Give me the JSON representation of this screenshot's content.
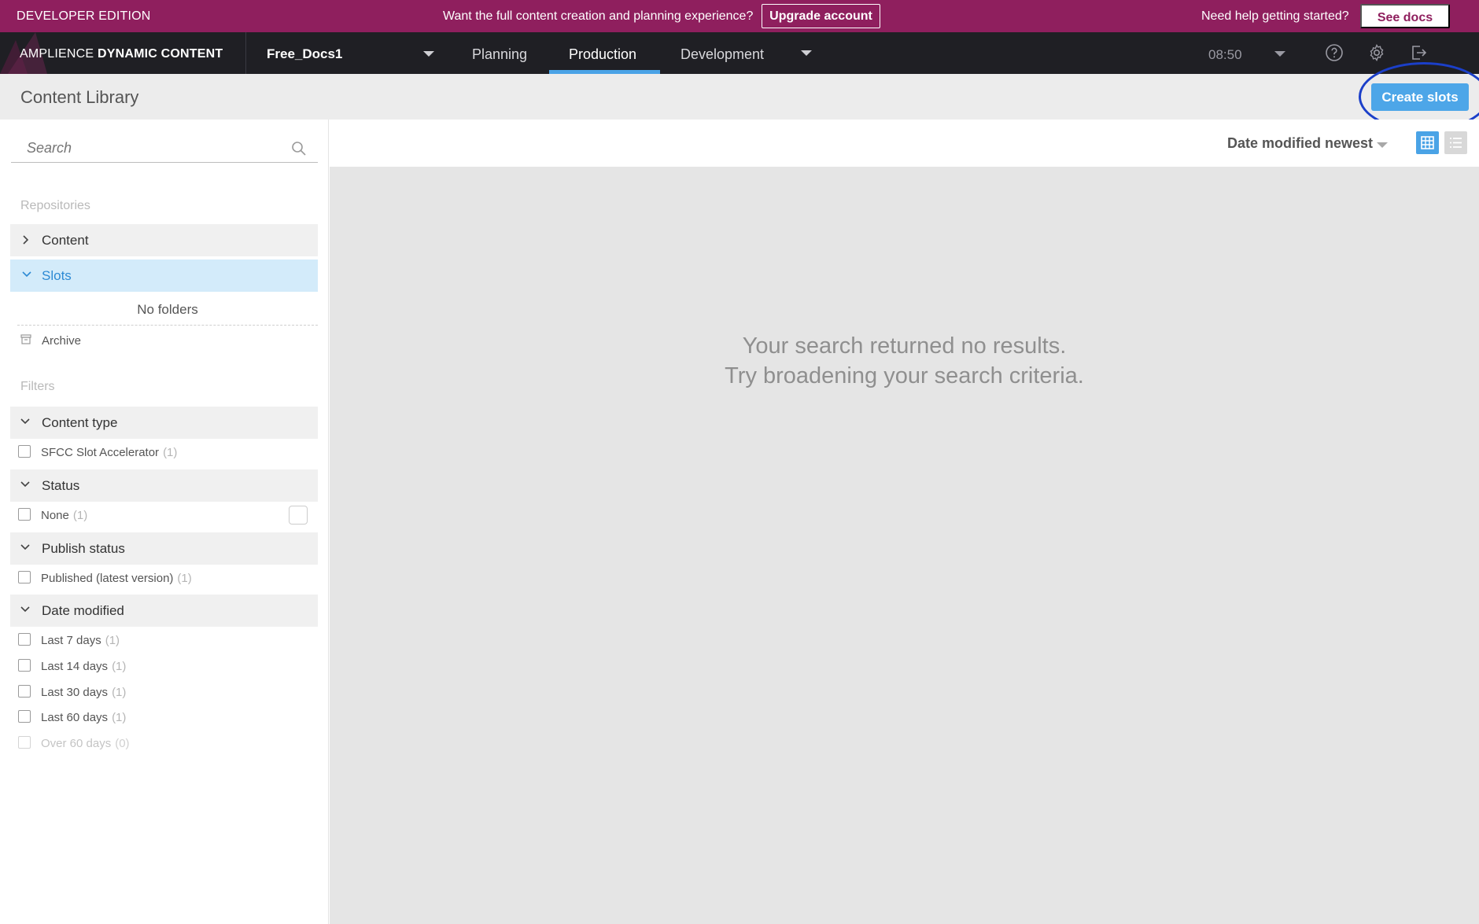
{
  "promo": {
    "edition": "DEVELOPER EDITION",
    "message": "Want the full content creation and planning experience?",
    "upgrade_label": "Upgrade account",
    "help_text": "Need help getting started?",
    "docs_label": "See docs"
  },
  "nav": {
    "brand_light": "AMPLIENCE",
    "brand_bold": "DYNAMIC CONTENT",
    "hub": "Free_Docs1",
    "tabs": [
      {
        "label": "Planning",
        "active": false
      },
      {
        "label": "Production",
        "active": true
      },
      {
        "label": "Development",
        "active": false
      }
    ],
    "time": "08:50",
    "icons": [
      "help-icon",
      "gear-icon",
      "logout-icon"
    ]
  },
  "header": {
    "title": "Content Library",
    "create_label": "Create slots"
  },
  "sidebar": {
    "search_placeholder": "Search",
    "repositories_label": "Repositories",
    "repositories": [
      {
        "label": "Content",
        "expanded": false,
        "selected": false
      },
      {
        "label": "Slots",
        "expanded": true,
        "selected": true
      }
    ],
    "no_folders": "No folders",
    "archive_label": "Archive",
    "filters_label": "Filters",
    "filters": {
      "content_type": {
        "label": "Content type",
        "items": [
          {
            "label": "SFCC Slot Accelerator",
            "count": "(1)"
          }
        ]
      },
      "status": {
        "label": "Status",
        "items": [
          {
            "label": "None",
            "count": "(1)"
          }
        ]
      },
      "publish_status": {
        "label": "Publish status",
        "items": [
          {
            "label": "Published (latest version)",
            "count": "(1)"
          }
        ]
      },
      "date_modified": {
        "label": "Date modified",
        "items": [
          {
            "label": "Last 7 days",
            "count": "(1)"
          },
          {
            "label": "Last 14 days",
            "count": "(1)"
          },
          {
            "label": "Last 30 days",
            "count": "(1)"
          },
          {
            "label": "Last 60 days",
            "count": "(1)"
          },
          {
            "label": "Over 60 days",
            "count": "(0)",
            "disabled": true
          }
        ]
      }
    }
  },
  "toolbar": {
    "sort_label": "Date modified newest",
    "view_mode": "grid"
  },
  "main": {
    "empty_line1": "Your search returned no results.",
    "empty_line2": "Try broadening your search criteria."
  },
  "colors": {
    "promo_bg": "#8f1f5e",
    "nav_bg": "#1f1f24",
    "accent": "#4aa3e6",
    "highlight_ring": "#1b3fc9"
  }
}
